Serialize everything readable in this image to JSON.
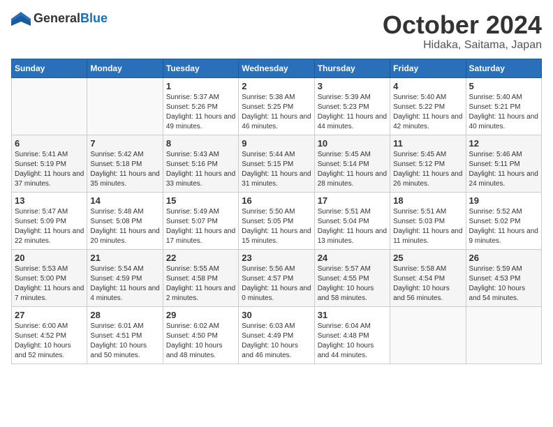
{
  "logo": {
    "general": "General",
    "blue": "Blue"
  },
  "header": {
    "month": "October 2024",
    "location": "Hidaka, Saitama, Japan"
  },
  "weekdays": [
    "Sunday",
    "Monday",
    "Tuesday",
    "Wednesday",
    "Thursday",
    "Friday",
    "Saturday"
  ],
  "weeks": [
    [
      {
        "day": "",
        "content": ""
      },
      {
        "day": "",
        "content": ""
      },
      {
        "day": "1",
        "content": "Sunrise: 5:37 AM\nSunset: 5:26 PM\nDaylight: 11 hours and 49 minutes."
      },
      {
        "day": "2",
        "content": "Sunrise: 5:38 AM\nSunset: 5:25 PM\nDaylight: 11 hours and 46 minutes."
      },
      {
        "day": "3",
        "content": "Sunrise: 5:39 AM\nSunset: 5:23 PM\nDaylight: 11 hours and 44 minutes."
      },
      {
        "day": "4",
        "content": "Sunrise: 5:40 AM\nSunset: 5:22 PM\nDaylight: 11 hours and 42 minutes."
      },
      {
        "day": "5",
        "content": "Sunrise: 5:40 AM\nSunset: 5:21 PM\nDaylight: 11 hours and 40 minutes."
      }
    ],
    [
      {
        "day": "6",
        "content": "Sunrise: 5:41 AM\nSunset: 5:19 PM\nDaylight: 11 hours and 37 minutes."
      },
      {
        "day": "7",
        "content": "Sunrise: 5:42 AM\nSunset: 5:18 PM\nDaylight: 11 hours and 35 minutes."
      },
      {
        "day": "8",
        "content": "Sunrise: 5:43 AM\nSunset: 5:16 PM\nDaylight: 11 hours and 33 minutes."
      },
      {
        "day": "9",
        "content": "Sunrise: 5:44 AM\nSunset: 5:15 PM\nDaylight: 11 hours and 31 minutes."
      },
      {
        "day": "10",
        "content": "Sunrise: 5:45 AM\nSunset: 5:14 PM\nDaylight: 11 hours and 28 minutes."
      },
      {
        "day": "11",
        "content": "Sunrise: 5:45 AM\nSunset: 5:12 PM\nDaylight: 11 hours and 26 minutes."
      },
      {
        "day": "12",
        "content": "Sunrise: 5:46 AM\nSunset: 5:11 PM\nDaylight: 11 hours and 24 minutes."
      }
    ],
    [
      {
        "day": "13",
        "content": "Sunrise: 5:47 AM\nSunset: 5:09 PM\nDaylight: 11 hours and 22 minutes."
      },
      {
        "day": "14",
        "content": "Sunrise: 5:48 AM\nSunset: 5:08 PM\nDaylight: 11 hours and 20 minutes."
      },
      {
        "day": "15",
        "content": "Sunrise: 5:49 AM\nSunset: 5:07 PM\nDaylight: 11 hours and 17 minutes."
      },
      {
        "day": "16",
        "content": "Sunrise: 5:50 AM\nSunset: 5:05 PM\nDaylight: 11 hours and 15 minutes."
      },
      {
        "day": "17",
        "content": "Sunrise: 5:51 AM\nSunset: 5:04 PM\nDaylight: 11 hours and 13 minutes."
      },
      {
        "day": "18",
        "content": "Sunrise: 5:51 AM\nSunset: 5:03 PM\nDaylight: 11 hours and 11 minutes."
      },
      {
        "day": "19",
        "content": "Sunrise: 5:52 AM\nSunset: 5:02 PM\nDaylight: 11 hours and 9 minutes."
      }
    ],
    [
      {
        "day": "20",
        "content": "Sunrise: 5:53 AM\nSunset: 5:00 PM\nDaylight: 11 hours and 7 minutes."
      },
      {
        "day": "21",
        "content": "Sunrise: 5:54 AM\nSunset: 4:59 PM\nDaylight: 11 hours and 4 minutes."
      },
      {
        "day": "22",
        "content": "Sunrise: 5:55 AM\nSunset: 4:58 PM\nDaylight: 11 hours and 2 minutes."
      },
      {
        "day": "23",
        "content": "Sunrise: 5:56 AM\nSunset: 4:57 PM\nDaylight: 11 hours and 0 minutes."
      },
      {
        "day": "24",
        "content": "Sunrise: 5:57 AM\nSunset: 4:55 PM\nDaylight: 10 hours and 58 minutes."
      },
      {
        "day": "25",
        "content": "Sunrise: 5:58 AM\nSunset: 4:54 PM\nDaylight: 10 hours and 56 minutes."
      },
      {
        "day": "26",
        "content": "Sunrise: 5:59 AM\nSunset: 4:53 PM\nDaylight: 10 hours and 54 minutes."
      }
    ],
    [
      {
        "day": "27",
        "content": "Sunrise: 6:00 AM\nSunset: 4:52 PM\nDaylight: 10 hours and 52 minutes."
      },
      {
        "day": "28",
        "content": "Sunrise: 6:01 AM\nSunset: 4:51 PM\nDaylight: 10 hours and 50 minutes."
      },
      {
        "day": "29",
        "content": "Sunrise: 6:02 AM\nSunset: 4:50 PM\nDaylight: 10 hours and 48 minutes."
      },
      {
        "day": "30",
        "content": "Sunrise: 6:03 AM\nSunset: 4:49 PM\nDaylight: 10 hours and 46 minutes."
      },
      {
        "day": "31",
        "content": "Sunrise: 6:04 AM\nSunset: 4:48 PM\nDaylight: 10 hours and 44 minutes."
      },
      {
        "day": "",
        "content": ""
      },
      {
        "day": "",
        "content": ""
      }
    ]
  ]
}
